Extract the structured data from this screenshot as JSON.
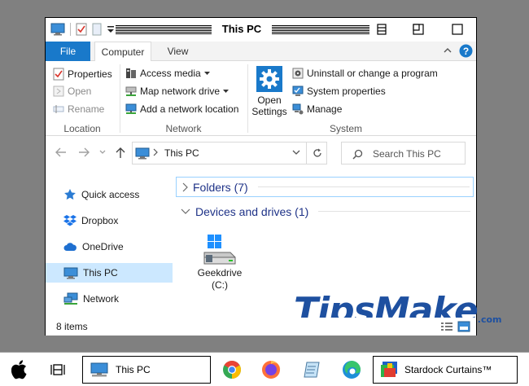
{
  "window": {
    "title": "This PC",
    "tabs": {
      "file": "File",
      "computer": "Computer",
      "view": "View"
    }
  },
  "ribbon": {
    "location": {
      "label": "Location",
      "properties": "Properties",
      "open": "Open",
      "rename": "Rename"
    },
    "network": {
      "label": "Network",
      "access_media": "Access media",
      "map_network_drive": "Map network drive",
      "add_network_location": "Add a network location"
    },
    "system": {
      "label": "System",
      "open_settings_line1": "Open",
      "open_settings_line2": "Settings",
      "uninstall": "Uninstall or change a program",
      "system_properties": "System properties",
      "manage": "Manage"
    }
  },
  "address": {
    "path": "This PC",
    "search_placeholder": "Search This PC"
  },
  "nav_pane": {
    "items": [
      {
        "label": "Quick access",
        "icon": "star-icon"
      },
      {
        "label": "Dropbox",
        "icon": "dropbox-icon"
      },
      {
        "label": "OneDrive",
        "icon": "cloud-icon"
      },
      {
        "label": "This PC",
        "icon": "monitor-icon",
        "selected": true
      },
      {
        "label": "Network",
        "icon": "network-icon"
      }
    ]
  },
  "content": {
    "folders_header": "Folders (7)",
    "devices_header": "Devices and drives (1)",
    "drive": {
      "name": "Geekdrive",
      "letter": "(C:)"
    }
  },
  "watermark": {
    "text": "TipsMake",
    "suffix": ".com"
  },
  "status": {
    "count": "8 items"
  },
  "taskbar": {
    "active_window": "This PC",
    "stardock": "Stardock Curtains™"
  },
  "colors": {
    "accent": "#1979ca",
    "selection": "#cce8ff",
    "group_header": "#1e3287",
    "watermark": "#1e50a0"
  }
}
